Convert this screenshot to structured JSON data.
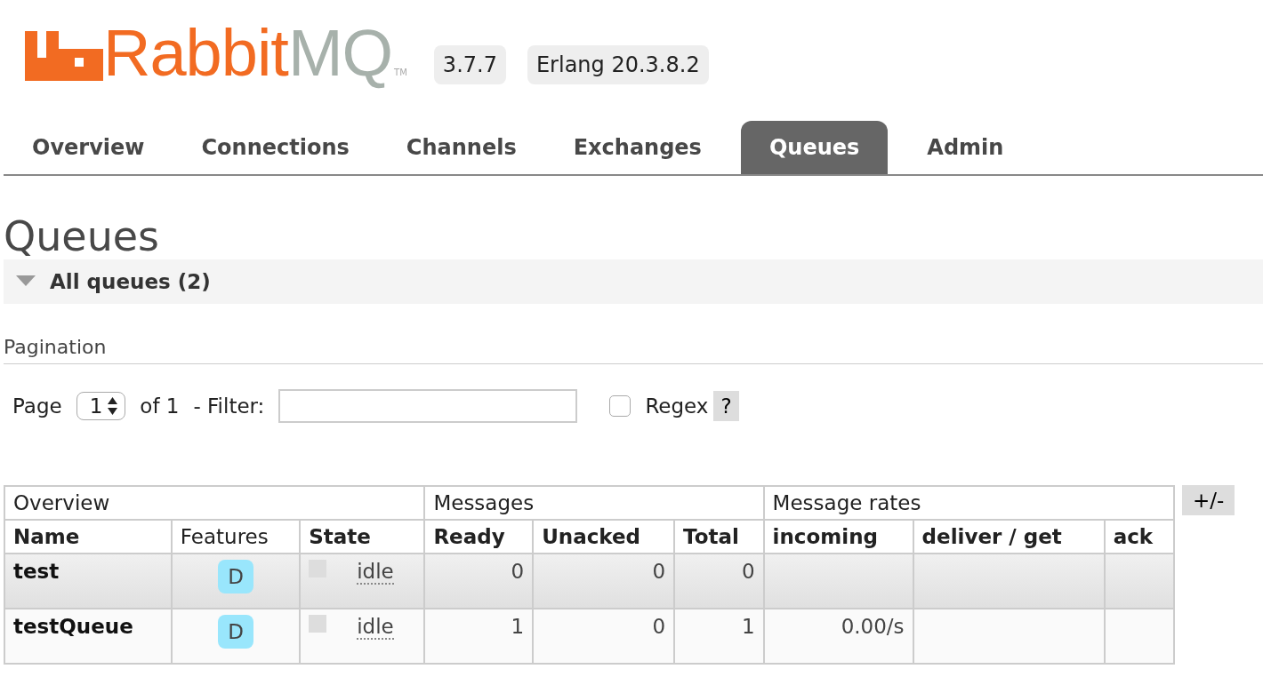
{
  "logo": {
    "part_1": "Rabbit",
    "part_2": "MQ",
    "trademark": "TM"
  },
  "badges": [
    "3.7.7",
    "Erlang 20.3.8.2"
  ],
  "tabs": [
    {
      "label": "Overview",
      "selected": false
    },
    {
      "label": "Connections",
      "selected": false
    },
    {
      "label": "Channels",
      "selected": false
    },
    {
      "label": "Exchanges",
      "selected": false
    },
    {
      "label": "Queues",
      "selected": true
    },
    {
      "label": "Admin",
      "selected": false
    }
  ],
  "page_title": "Queues",
  "section": {
    "title": "All queues (2)",
    "expanded": true
  },
  "pagination": {
    "heading": "Pagination",
    "page_label": "Page",
    "page_value": "1",
    "of_label": "of 1",
    "filter_label": "- Filter:",
    "regex": {
      "label": "Regex",
      "checked": false
    },
    "help": "?"
  },
  "table": {
    "groups": [
      "Overview",
      "Messages",
      "Message rates"
    ],
    "columns": [
      "Name",
      "Features",
      "State",
      "Ready",
      "Unacked",
      "Total",
      "incoming",
      "deliver / get",
      "ack"
    ],
    "rows": [
      {
        "name": "test",
        "feature": "D",
        "state": "idle",
        "ready": "0",
        "unacked": "0",
        "total": "0",
        "highlighted": true
      },
      {
        "name": "testQueue",
        "feature": "D",
        "state": "idle",
        "ready": "1",
        "unacked": "0",
        "total": "1",
        "incoming": "0.00/s",
        "highlighted": false
      }
    ],
    "columns_toggle": "+/-"
  }
}
